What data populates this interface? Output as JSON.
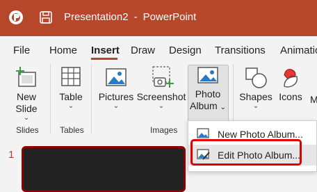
{
  "titlebar": {
    "document": "Presentation2",
    "separator": "-",
    "app": "PowerPoint",
    "color": "#b7472a"
  },
  "tabs": [
    "File",
    "Home",
    "Insert",
    "Draw",
    "Design",
    "Transitions",
    "Animatio"
  ],
  "active_tab": "Insert",
  "ribbon": {
    "new_slide": {
      "line1": "New",
      "line2": "Slide"
    },
    "table": {
      "label": "Table"
    },
    "pictures": {
      "label": "Pictures"
    },
    "screenshot": {
      "label": "Screenshot"
    },
    "photo_album": {
      "line1": "Photo",
      "line2": "Album"
    },
    "shapes": {
      "label": "Shapes"
    },
    "icons": {
      "label": "Icons"
    },
    "cut_label": "M",
    "groups": {
      "slides": "Slides",
      "tables": "Tables",
      "images": "Images"
    }
  },
  "slide_pane": {
    "number": "1"
  },
  "dropdown": {
    "items": [
      {
        "label": "New Photo Album...",
        "icon": "photo-album-icon"
      },
      {
        "label": "Edit Photo Album...",
        "icon": "edit-photo-album-icon",
        "highlighted": true
      }
    ]
  },
  "colors": {
    "accent": "#b7472a",
    "callout": "#e00000"
  }
}
